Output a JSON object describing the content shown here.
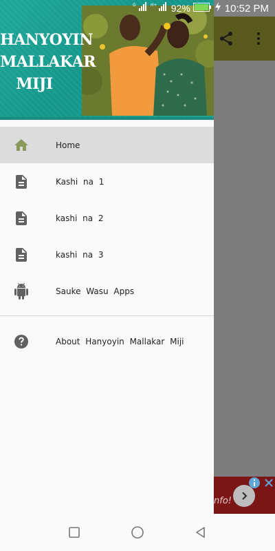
{
  "status_bar": {
    "battery_percent": "92%",
    "time": "10:52 PM"
  },
  "drawer": {
    "header_title_lines": [
      "HANYOYIN",
      "MALLAKAR",
      "MIJI"
    ],
    "items": [
      {
        "label": "Home",
        "icon": "home-icon",
        "selected": true
      },
      {
        "label": "Kashi na 1",
        "icon": "document-icon",
        "selected": false
      },
      {
        "label": "kashi na 2",
        "icon": "document-icon",
        "selected": false
      },
      {
        "label": "kashi na 3",
        "icon": "document-icon",
        "selected": false
      },
      {
        "label": "Sauke Wasu Apps",
        "icon": "android-icon",
        "selected": false
      }
    ],
    "secondary_items": [
      {
        "label": "About Hanyoyin Mallakar Miji",
        "icon": "help-icon"
      }
    ]
  },
  "ad": {
    "text": "nfo!"
  },
  "colors": {
    "header_teal": "#1fa89a",
    "selected_bg": "#dcdcdc",
    "home_icon": "#8a9a5b",
    "icon_gray": "#616161"
  }
}
